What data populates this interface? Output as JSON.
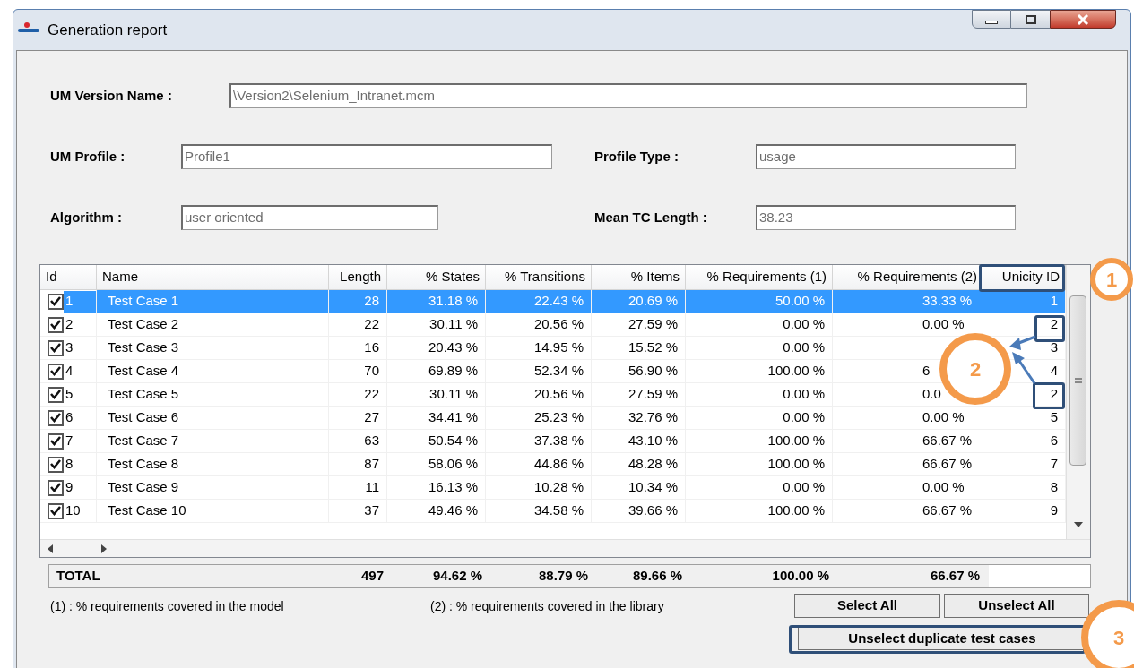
{
  "window": {
    "title": "Generation report"
  },
  "fields": [
    {
      "label": "UM Version Name :",
      "value": "\\Version2\\Selenium_Intranet.mcm"
    },
    {
      "label": "UM Profile :",
      "value": "Profile1"
    },
    {
      "label": "Profile Type :",
      "value": "usage"
    },
    {
      "label": "Algorithm :",
      "value": "user oriented"
    },
    {
      "label": "Mean TC Length :",
      "value": "38.23"
    }
  ],
  "table": {
    "columns": [
      "Id",
      "Name",
      "Length",
      "% States",
      "% Transitions",
      "% Items",
      "% Requirements (1)",
      "% Requirements (2)",
      "Unicity ID"
    ],
    "rows": [
      {
        "checked": true,
        "selected": true,
        "cells": [
          "1",
          "Test Case 1",
          "28",
          "31.18 %",
          "22.43 %",
          "20.69 %",
          "50.00 %",
          "33.33 %",
          "1"
        ]
      },
      {
        "checked": true,
        "selected": false,
        "cells": [
          "2",
          "Test Case 2",
          "22",
          "30.11 %",
          "20.56 %",
          "27.59 %",
          "0.00 %",
          "0.00 %",
          "2"
        ]
      },
      {
        "checked": true,
        "selected": false,
        "cells": [
          "3",
          "Test Case 3",
          "16",
          "20.43 %",
          "14.95 %",
          "15.52 %",
          "0.00 %",
          "",
          "3"
        ]
      },
      {
        "checked": true,
        "selected": false,
        "cells": [
          "4",
          "Test Case 4",
          "70",
          "69.89 %",
          "52.34 %",
          "56.90 %",
          "100.00 %",
          "6",
          "4"
        ]
      },
      {
        "checked": true,
        "selected": false,
        "cells": [
          "5",
          "Test Case 5",
          "22",
          "30.11 %",
          "20.56 %",
          "27.59 %",
          "0.00 %",
          "0.0",
          "2"
        ]
      },
      {
        "checked": true,
        "selected": false,
        "cells": [
          "6",
          "Test Case 6",
          "27",
          "34.41 %",
          "25.23 %",
          "32.76 %",
          "0.00 %",
          "0.00 %",
          "5"
        ]
      },
      {
        "checked": true,
        "selected": false,
        "cells": [
          "7",
          "Test Case 7",
          "63",
          "50.54 %",
          "37.38 %",
          "43.10 %",
          "100.00 %",
          "66.67 %",
          "6"
        ]
      },
      {
        "checked": true,
        "selected": false,
        "cells": [
          "8",
          "Test Case 8",
          "87",
          "58.06 %",
          "44.86 %",
          "48.28 %",
          "100.00 %",
          "66.67 %",
          "7"
        ]
      },
      {
        "checked": true,
        "selected": false,
        "cells": [
          "9",
          "Test Case 9",
          "11",
          "16.13 %",
          "10.28 %",
          "10.34 %",
          "0.00 %",
          "0.00 %",
          "8"
        ]
      },
      {
        "checked": true,
        "selected": false,
        "cells": [
          "10",
          "Test Case 10",
          "37",
          "49.46 %",
          "34.58 %",
          "39.66 %",
          "100.00 %",
          "66.67 %",
          "9"
        ]
      }
    ],
    "total": {
      "label": "TOTAL",
      "values": [
        "497",
        "94.62 %",
        "88.79 %",
        "89.66 %",
        "100.00 %",
        "66.67 %"
      ]
    }
  },
  "footnotes": [
    "(1) : % requirements covered in the model",
    "(2) : % requirements covered in the library"
  ],
  "buttons": [
    "Select All",
    "Unselect All",
    "Unselect duplicate test cases"
  ],
  "callouts": [
    "1",
    "2",
    "3"
  ]
}
